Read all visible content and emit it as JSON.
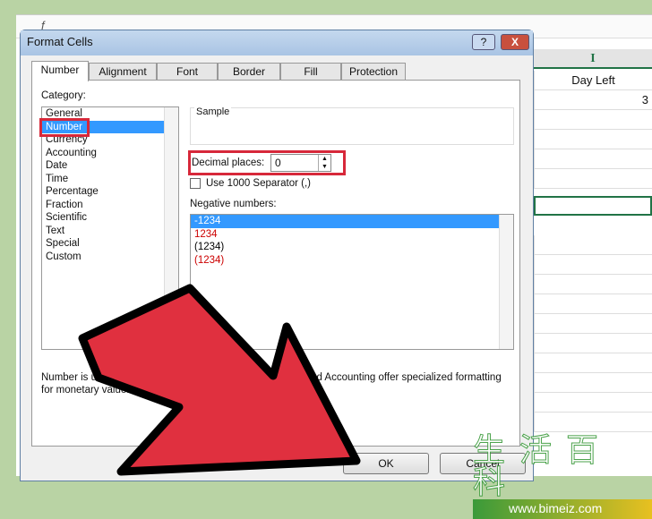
{
  "spreadsheet": {
    "formula_symbol": "f",
    "column_header": "I",
    "header_cell": "Day Left",
    "value_cell": "3"
  },
  "dialog": {
    "title": "Format Cells",
    "help_label": "?",
    "close_label": "X",
    "tabs": [
      "Number",
      "Alignment",
      "Font",
      "Border",
      "Fill",
      "Protection"
    ],
    "category_label": "Category:",
    "categories": [
      "General",
      "Number",
      "Currency",
      "Accounting",
      "Date",
      "Time",
      "Percentage",
      "Fraction",
      "Scientific",
      "Text",
      "Special",
      "Custom"
    ],
    "selected_category": "Number",
    "sample_label": "Sample",
    "decimal_label": "Decimal places:",
    "decimal_value": "0",
    "separator_label": "Use 1000 Separator (,)",
    "separator_checked": false,
    "negative_label": "Negative numbers:",
    "negative_options": [
      {
        "text": "-1234",
        "color": "#000000"
      },
      {
        "text": "1234",
        "color": "#cc0000"
      },
      {
        "text": "(1234)",
        "color": "#000000"
      },
      {
        "text": "(1234)",
        "color": "#cc0000"
      }
    ],
    "description": "Number is used for general display of numbers. Currency and Accounting offer specialized formatting for monetary value.",
    "ok_label": "OK",
    "cancel_label": "Cancel"
  },
  "watermark": {
    "text": "生活百科",
    "url": "www.bimeiz.com"
  },
  "colors": {
    "arrow": "#e0303f",
    "highlight": "#d7283a",
    "selection": "#3399ff"
  }
}
